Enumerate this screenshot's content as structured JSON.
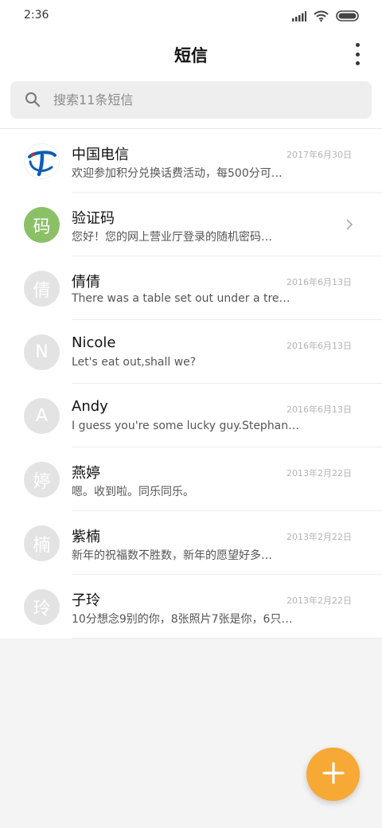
{
  "status_bar": {
    "time": "2:36",
    "icons": [
      "signal-icon",
      "wifi-icon",
      "battery-icon"
    ]
  },
  "app_bar": {
    "title": "短信",
    "more_icon": "more-vertical-icon"
  },
  "search": {
    "placeholder": "搜索11条短信",
    "icon": "search-icon"
  },
  "colors": {
    "accent": "#f7a936",
    "verification_avatar": "#8bc067",
    "telecom_blue": "#0d5eb3",
    "avatar_gray": "#e3e3e3"
  },
  "conversations": [
    {
      "name": "中国电信",
      "date": "2017年6月30日",
      "preview": "欢迎参加积分兑换话费活动，每500分可…",
      "avatar_text": "",
      "avatar": "china-telecom-logo-icon"
    },
    {
      "name": "验证码",
      "date": "",
      "preview": "您好！您的网上营业厅登录的随机密码…",
      "avatar_text": "码",
      "avatar": "verification-code-icon"
    },
    {
      "name": "倩倩",
      "date": "2016年6月13日",
      "preview": "There was a table set out under a tre…",
      "avatar_text": "倩",
      "avatar": "contact-avatar"
    },
    {
      "name": "Nicole",
      "date": "2016年6月13日",
      "preview": "Let's eat out,shall we?",
      "avatar_text": "N",
      "avatar": "contact-avatar"
    },
    {
      "name": "Andy",
      "date": "2016年6月13日",
      "preview": "I guess you're some lucky guy.Stephani…",
      "avatar_text": "A",
      "avatar": "contact-avatar"
    },
    {
      "name": "燕婷",
      "date": "2013年2月22日",
      "preview": "嗯。收到啦。同乐同乐。",
      "avatar_text": "婷",
      "avatar": "contact-avatar"
    },
    {
      "name": "紫楠",
      "date": "2013年2月22日",
      "preview": "新年的祝福数不胜数，新年的愿望好多…",
      "avatar_text": "楠",
      "avatar": "contact-avatar"
    },
    {
      "name": "子玲",
      "date": "2013年2月22日",
      "preview": "10分想念9别的你，8张照片7张是你，6只…",
      "avatar_text": "玲",
      "avatar": "contact-avatar"
    }
  ],
  "fab": {
    "icon": "plus-icon"
  }
}
